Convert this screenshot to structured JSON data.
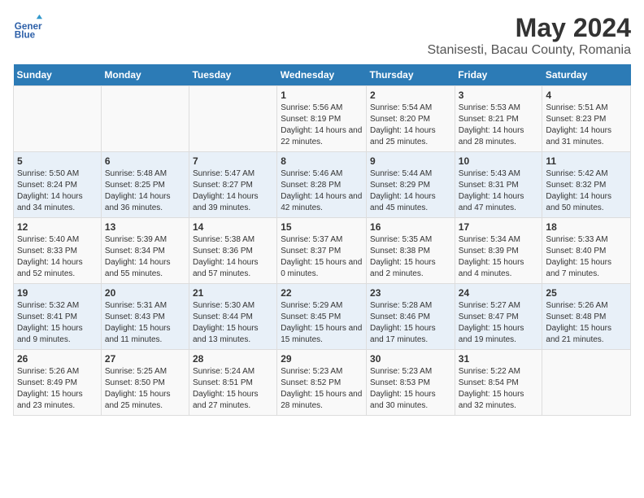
{
  "header": {
    "logo_line1": "General",
    "logo_line2": "Blue",
    "main_title": "May 2024",
    "subtitle": "Stanisesti, Bacau County, Romania"
  },
  "weekdays": [
    "Sunday",
    "Monday",
    "Tuesday",
    "Wednesday",
    "Thursday",
    "Friday",
    "Saturday"
  ],
  "weeks": [
    [
      {
        "day": "",
        "info": ""
      },
      {
        "day": "",
        "info": ""
      },
      {
        "day": "",
        "info": ""
      },
      {
        "day": "1",
        "info": "Sunrise: 5:56 AM\nSunset: 8:19 PM\nDaylight: 14 hours\nand 22 minutes."
      },
      {
        "day": "2",
        "info": "Sunrise: 5:54 AM\nSunset: 8:20 PM\nDaylight: 14 hours\nand 25 minutes."
      },
      {
        "day": "3",
        "info": "Sunrise: 5:53 AM\nSunset: 8:21 PM\nDaylight: 14 hours\nand 28 minutes."
      },
      {
        "day": "4",
        "info": "Sunrise: 5:51 AM\nSunset: 8:23 PM\nDaylight: 14 hours\nand 31 minutes."
      }
    ],
    [
      {
        "day": "5",
        "info": "Sunrise: 5:50 AM\nSunset: 8:24 PM\nDaylight: 14 hours\nand 34 minutes."
      },
      {
        "day": "6",
        "info": "Sunrise: 5:48 AM\nSunset: 8:25 PM\nDaylight: 14 hours\nand 36 minutes."
      },
      {
        "day": "7",
        "info": "Sunrise: 5:47 AM\nSunset: 8:27 PM\nDaylight: 14 hours\nand 39 minutes."
      },
      {
        "day": "8",
        "info": "Sunrise: 5:46 AM\nSunset: 8:28 PM\nDaylight: 14 hours\nand 42 minutes."
      },
      {
        "day": "9",
        "info": "Sunrise: 5:44 AM\nSunset: 8:29 PM\nDaylight: 14 hours\nand 45 minutes."
      },
      {
        "day": "10",
        "info": "Sunrise: 5:43 AM\nSunset: 8:31 PM\nDaylight: 14 hours\nand 47 minutes."
      },
      {
        "day": "11",
        "info": "Sunrise: 5:42 AM\nSunset: 8:32 PM\nDaylight: 14 hours\nand 50 minutes."
      }
    ],
    [
      {
        "day": "12",
        "info": "Sunrise: 5:40 AM\nSunset: 8:33 PM\nDaylight: 14 hours\nand 52 minutes."
      },
      {
        "day": "13",
        "info": "Sunrise: 5:39 AM\nSunset: 8:34 PM\nDaylight: 14 hours\nand 55 minutes."
      },
      {
        "day": "14",
        "info": "Sunrise: 5:38 AM\nSunset: 8:36 PM\nDaylight: 14 hours\nand 57 minutes."
      },
      {
        "day": "15",
        "info": "Sunrise: 5:37 AM\nSunset: 8:37 PM\nDaylight: 15 hours\nand 0 minutes."
      },
      {
        "day": "16",
        "info": "Sunrise: 5:35 AM\nSunset: 8:38 PM\nDaylight: 15 hours\nand 2 minutes."
      },
      {
        "day": "17",
        "info": "Sunrise: 5:34 AM\nSunset: 8:39 PM\nDaylight: 15 hours\nand 4 minutes."
      },
      {
        "day": "18",
        "info": "Sunrise: 5:33 AM\nSunset: 8:40 PM\nDaylight: 15 hours\nand 7 minutes."
      }
    ],
    [
      {
        "day": "19",
        "info": "Sunrise: 5:32 AM\nSunset: 8:41 PM\nDaylight: 15 hours\nand 9 minutes."
      },
      {
        "day": "20",
        "info": "Sunrise: 5:31 AM\nSunset: 8:43 PM\nDaylight: 15 hours\nand 11 minutes."
      },
      {
        "day": "21",
        "info": "Sunrise: 5:30 AM\nSunset: 8:44 PM\nDaylight: 15 hours\nand 13 minutes."
      },
      {
        "day": "22",
        "info": "Sunrise: 5:29 AM\nSunset: 8:45 PM\nDaylight: 15 hours\nand 15 minutes."
      },
      {
        "day": "23",
        "info": "Sunrise: 5:28 AM\nSunset: 8:46 PM\nDaylight: 15 hours\nand 17 minutes."
      },
      {
        "day": "24",
        "info": "Sunrise: 5:27 AM\nSunset: 8:47 PM\nDaylight: 15 hours\nand 19 minutes."
      },
      {
        "day": "25",
        "info": "Sunrise: 5:26 AM\nSunset: 8:48 PM\nDaylight: 15 hours\nand 21 minutes."
      }
    ],
    [
      {
        "day": "26",
        "info": "Sunrise: 5:26 AM\nSunset: 8:49 PM\nDaylight: 15 hours\nand 23 minutes."
      },
      {
        "day": "27",
        "info": "Sunrise: 5:25 AM\nSunset: 8:50 PM\nDaylight: 15 hours\nand 25 minutes."
      },
      {
        "day": "28",
        "info": "Sunrise: 5:24 AM\nSunset: 8:51 PM\nDaylight: 15 hours\nand 27 minutes."
      },
      {
        "day": "29",
        "info": "Sunrise: 5:23 AM\nSunset: 8:52 PM\nDaylight: 15 hours\nand 28 minutes."
      },
      {
        "day": "30",
        "info": "Sunrise: 5:23 AM\nSunset: 8:53 PM\nDaylight: 15 hours\nand 30 minutes."
      },
      {
        "day": "31",
        "info": "Sunrise: 5:22 AM\nSunset: 8:54 PM\nDaylight: 15 hours\nand 32 minutes."
      },
      {
        "day": "",
        "info": ""
      }
    ]
  ]
}
